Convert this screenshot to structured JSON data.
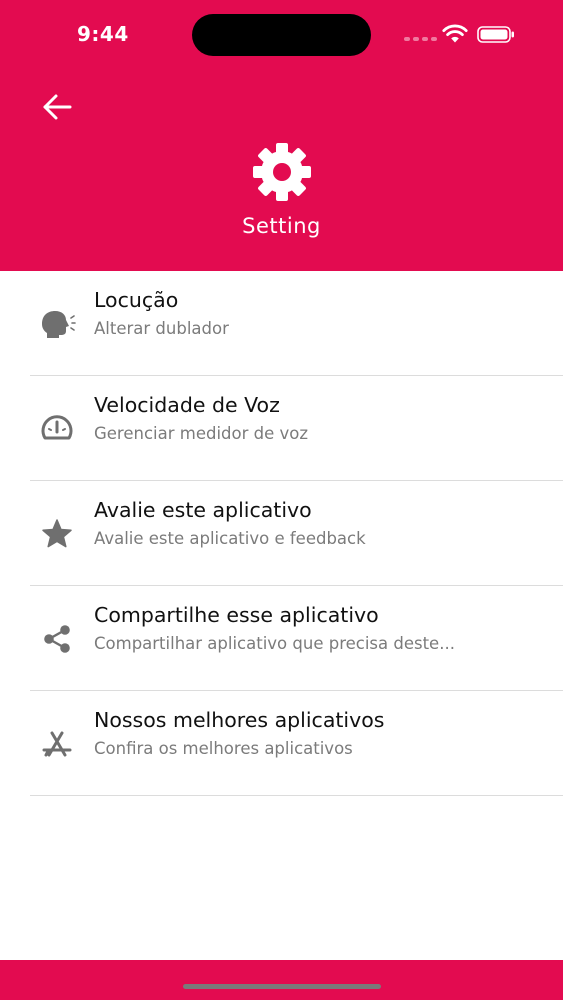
{
  "status_bar": {
    "time": "9:44"
  },
  "header": {
    "title": "Setting",
    "background_color": "#E30B50",
    "icon": "gear-icon",
    "back_icon": "arrow-left-icon"
  },
  "settings": {
    "items": [
      {
        "title": "Locução",
        "subtitle": "Alterar dublador",
        "icon": "speaking-head-icon"
      },
      {
        "title": "Velocidade de Voz",
        "subtitle": "Gerenciar medidor de voz",
        "icon": "speedometer-icon"
      },
      {
        "title": "Avalie este aplicativo",
        "subtitle": "Avalie este aplicativo e feedback",
        "icon": "star-icon"
      },
      {
        "title": "Compartilhe esse aplicativo",
        "subtitle": "Compartilhar aplicativo que precisa deste...",
        "icon": "share-icon"
      },
      {
        "title": "Nossos melhores aplicativos",
        "subtitle": "Confira os melhores aplicativos",
        "icon": "app-store-icon"
      }
    ]
  },
  "colors": {
    "accent": "#E30B50",
    "title_text": "#111111",
    "subtitle_text": "#7B7B7B",
    "icon": "#6F6F6F",
    "divider": "#DCDCDC"
  }
}
